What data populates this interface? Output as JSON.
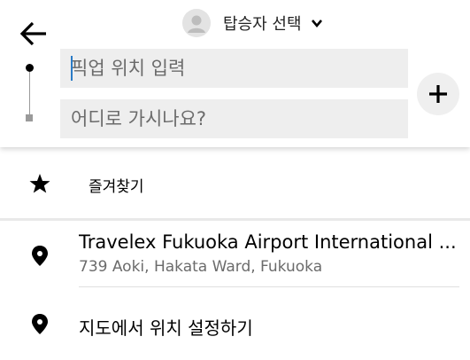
{
  "header": {
    "rider_label": "탑승자 선택",
    "pickup_placeholder": "픽업 위치 입력",
    "destination_placeholder": "어디로 가시나요?"
  },
  "suggestions": {
    "saved_label": "즐겨찾기",
    "place": {
      "title": "Travelex Fukuoka Airport International ...",
      "address": "739 Aoki, Hakata Ward, Fukuoka"
    },
    "set_on_map_label": "지도에서 위치 설정하기"
  },
  "icons": {
    "back": "arrow-left-icon",
    "avatar": "person-icon",
    "chevron": "chevron-down-icon",
    "add": "plus-icon",
    "saved": "star-icon",
    "place": "location-pin-icon"
  },
  "colors": {
    "caret": "#2a7bc6",
    "field_bg": "#eeeeee",
    "secondary_text": "#6b6b6b"
  }
}
